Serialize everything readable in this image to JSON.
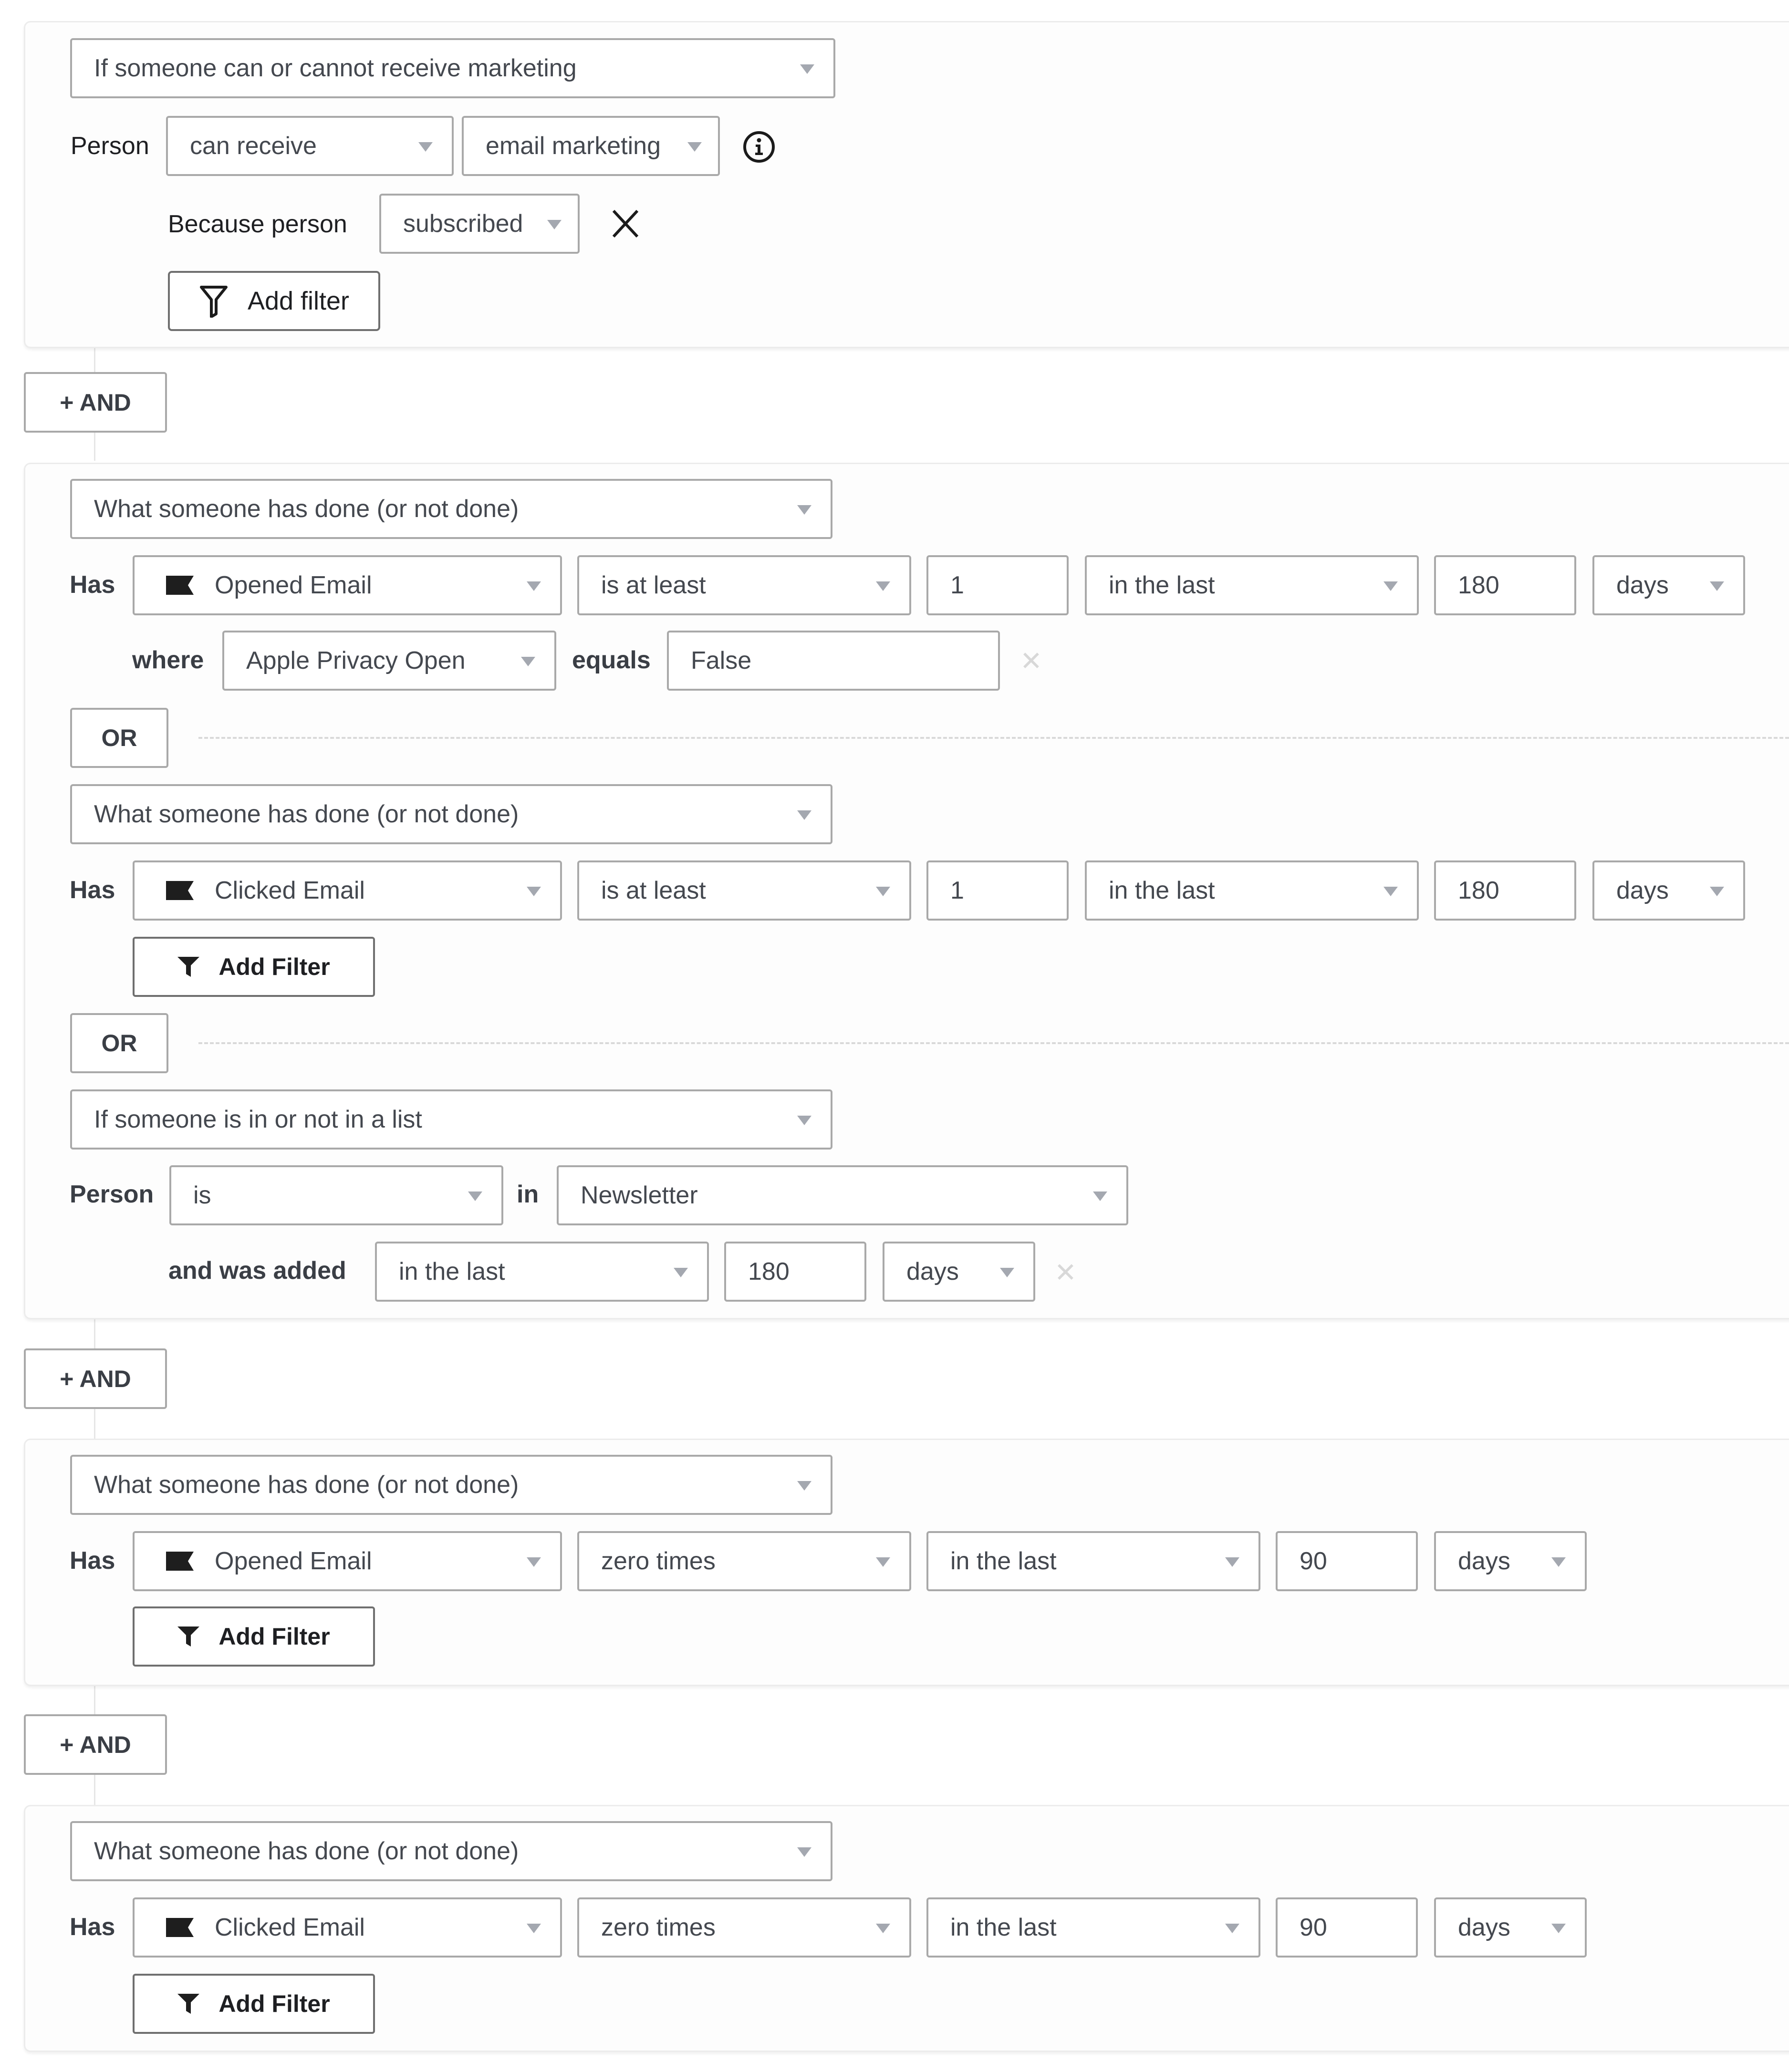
{
  "groups": [
    {
      "condition_type": "If someone can or cannot receive marketing",
      "person_label": "Person",
      "can_receive": "can receive",
      "channel": "email marketing",
      "because_label": "Because person",
      "because_value": "subscribed",
      "add_filter_label": "Add filter"
    },
    {
      "conditions": [
        {
          "condition_type": "What someone has done (or not done)",
          "has_label": "Has",
          "metric": "Opened Email",
          "operator": "is at least",
          "count": "1",
          "timeframe": "in the last",
          "period_value": "180",
          "period_unit": "days",
          "where_label": "where",
          "where_property": "Apple Privacy Open",
          "equals_label": "equals",
          "where_value": "False"
        },
        {
          "condition_type": "What someone has done (or not done)",
          "has_label": "Has",
          "metric": "Clicked Email",
          "operator": "is at least",
          "count": "1",
          "timeframe": "in the last",
          "period_value": "180",
          "period_unit": "days",
          "add_filter_label": "Add Filter"
        },
        {
          "condition_type": "If someone is in or not in a list",
          "person_label": "Person",
          "membership": "is",
          "in_label": "in",
          "list_name": "Newsletter",
          "added_label": "and was added",
          "timeframe": "in the last",
          "period_value": "180",
          "period_unit": "days"
        }
      ],
      "or_label": "OR"
    },
    {
      "condition_type": "What someone has done (or not done)",
      "has_label": "Has",
      "metric": "Opened Email",
      "operator": "zero times",
      "timeframe": "in the last",
      "period_value": "90",
      "period_unit": "days",
      "add_filter_label": "Add Filter"
    },
    {
      "condition_type": "What someone has done (or not done)",
      "has_label": "Has",
      "metric": "Clicked Email",
      "operator": "zero times",
      "timeframe": "in the last",
      "period_value": "90",
      "period_unit": "days",
      "add_filter_label": "Add Filter"
    }
  ],
  "and_button_label": "+ AND",
  "icons": {
    "caret": "chevron-down",
    "info": "info-circle",
    "remove": "close",
    "metric": "flag",
    "filter_outline": "funnel-outline",
    "filter_filled": "funnel-filled"
  }
}
